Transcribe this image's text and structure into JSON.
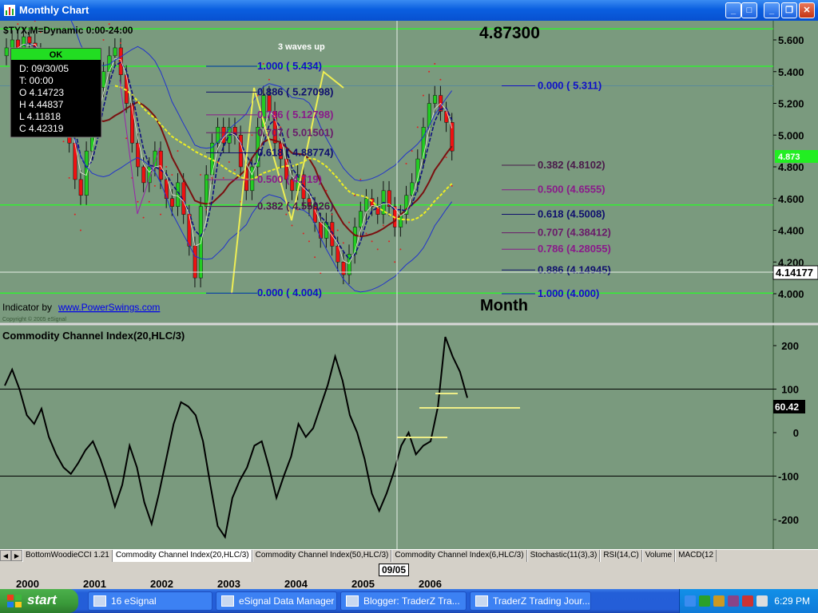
{
  "window": {
    "title": "Monthly Chart"
  },
  "chart_header": {
    "symbol": "$TYX,M=Dynamic 0:00-24:00"
  },
  "last_price_label": "4.87300",
  "info_box": {
    "status": "OK",
    "rows": [
      "D: 09/30/05",
      "T: 00:00",
      "O  4.14723",
      "H  4.44837",
      "L  4.11818",
      "C  4.42319"
    ]
  },
  "annotations": {
    "waves": "3 waves up",
    "indicator_credit": "Indicator by",
    "indicator_link": "www.PowerSwings.com",
    "copyright": "Copyright © 2005 eSignal",
    "period": "Month"
  },
  "fib_left": [
    {
      "label": "1.000 ( 5.434)",
      "color": "#1010c8"
    },
    {
      "label": "0.886 ( 5.27098)",
      "color": "#10106e"
    },
    {
      "label": "0.786 ( 5.12798)",
      "color": "#8a1a8a"
    },
    {
      "label": "0.707 ( 5.01501)",
      "color": "#6a1a6a"
    },
    {
      "label": "0.618 ( 4.88774)",
      "color": "#10106e"
    },
    {
      "label": "0.500 ( 4.719)",
      "color": "#8a1a8a"
    },
    {
      "label": "0.382 ( 4.55026)",
      "color": "#4a1a4a"
    },
    {
      "label": "0.000 ( 4.004)",
      "color": "#1010c8"
    }
  ],
  "fib_right": [
    {
      "label": "0.000 ( 5.311)",
      "color": "#1010c8"
    },
    {
      "label": "0.382 (4.8102)",
      "color": "#4a1a4a"
    },
    {
      "label": "0.500 (4.6555)",
      "color": "#8a1a8a"
    },
    {
      "label": "0.618 (4.5008)",
      "color": "#10106e"
    },
    {
      "label": "0.707 (4.38412)",
      "color": "#6a1a6a"
    },
    {
      "label": "0.786 (4.28055)",
      "color": "#8a1a8a"
    },
    {
      "label": "0.886 (4.14945)",
      "color": "#10106e"
    },
    {
      "label": "1.000 (4.000)",
      "color": "#1010c8"
    }
  ],
  "price_axis": {
    "ticks": [
      "5.600",
      "5.400",
      "5.200",
      "5.000",
      "4.800",
      "4.600",
      "4.400",
      "4.200",
      "4.000"
    ],
    "crosshair_value": "4.14177",
    "current_tag": "4.873"
  },
  "cci_panel": {
    "title": "Commodity Channel Index(20,HLC/3)",
    "ticks": [
      "200",
      "100",
      "0",
      "-100",
      "-200"
    ],
    "current_value": "60.42"
  },
  "cursor_date": "09/05",
  "tabs": [
    "BottomWoodieCCI 1.21",
    "Commodity Channel Index(20,HLC/3)",
    "Commodity Channel Index(50,HLC/3)",
    "Commodity Channel Index(6,HLC/3)",
    "Stochastic(11(3),3)",
    "RSI(14,C)",
    "Volume",
    "MACD(12"
  ],
  "active_tab": 1,
  "x_axis_years": [
    "2000",
    "2001",
    "2002",
    "2003",
    "2004",
    "2005",
    "2006"
  ],
  "taskbar": {
    "start_label": "start",
    "items": [
      {
        "label": "16 eSignal"
      },
      {
        "label": "eSignal Data Manager"
      },
      {
        "label": "Blogger: TraderZ Tra..."
      },
      {
        "label": "TraderZ Trading Jour..."
      }
    ],
    "clock": "6:29 PM"
  },
  "colors": {
    "bg": "#7a9a7e",
    "green_line": "#33ee33",
    "up_candle": "#22cc22",
    "down_candle": "#ee1111",
    "ma_dark": "#7a1010",
    "ma_yellow": "#eeee22",
    "ma_navy": "#101080",
    "band_blue": "#2233cc"
  },
  "chart_data": [
    {
      "type": "candlestick",
      "title": "",
      "interval": "monthly",
      "ylim": [
        3.9,
        5.7
      ],
      "horizontal_levels": [
        5.67,
        5.434,
        4.56,
        4.004
      ],
      "cursor_date": "09/05",
      "last_close_tag": 4.873,
      "fib_levels_left": {
        "1.000": 5.434,
        "0.886": 5.27098,
        "0.786": 5.12798,
        "0.707": 5.01501,
        "0.618": 4.88774,
        "0.500": 4.719,
        "0.382": 4.55026,
        "0.000": 4.004
      },
      "fib_levels_right": {
        "0.000": 5.311,
        "0.382": 4.8102,
        "0.500": 4.6555,
        "0.618": 4.5008,
        "0.707": 4.38412,
        "0.786": 4.28055,
        "0.886": 4.14945,
        "1.000": 4.0
      },
      "overlays": [
        "moving average (dark red)",
        "moving average (yellow dashed)",
        "moving average (navy dashed)",
        "bollinger-type bands (blue)",
        "parabolic SAR (red dots)"
      ],
      "highlighted_bar": {
        "date": "09/30/05",
        "open": 4.14723,
        "high": 4.44837,
        "low": 4.11818,
        "close": 4.42319
      }
    },
    {
      "type": "line",
      "title": "Commodity Channel Index(20,HLC/3)",
      "ylim": [
        -260,
        240
      ],
      "reference_lines": [
        100,
        -100
      ],
      "current_value": 60.42,
      "series": [
        {
          "values": [
            108,
            145,
            100,
            40,
            20,
            55,
            -10,
            -50,
            -80,
            -95,
            -70,
            -40,
            -20,
            -60,
            -110,
            -170,
            -120,
            -30,
            -80,
            -160,
            -210,
            -140,
            -60,
            20,
            70,
            60,
            40,
            -20,
            -120,
            -215,
            -240,
            -150,
            -110,
            -80,
            -30,
            -20,
            -80,
            -150,
            -100,
            -55,
            20,
            -10,
            10,
            60,
            110,
            175,
            120,
            40,
            0,
            -60,
            -140,
            -180,
            -140,
            -90,
            -30,
            0,
            -50,
            -30,
            -20,
            60,
            220,
            175,
            140,
            80
          ]
        }
      ]
    }
  ]
}
